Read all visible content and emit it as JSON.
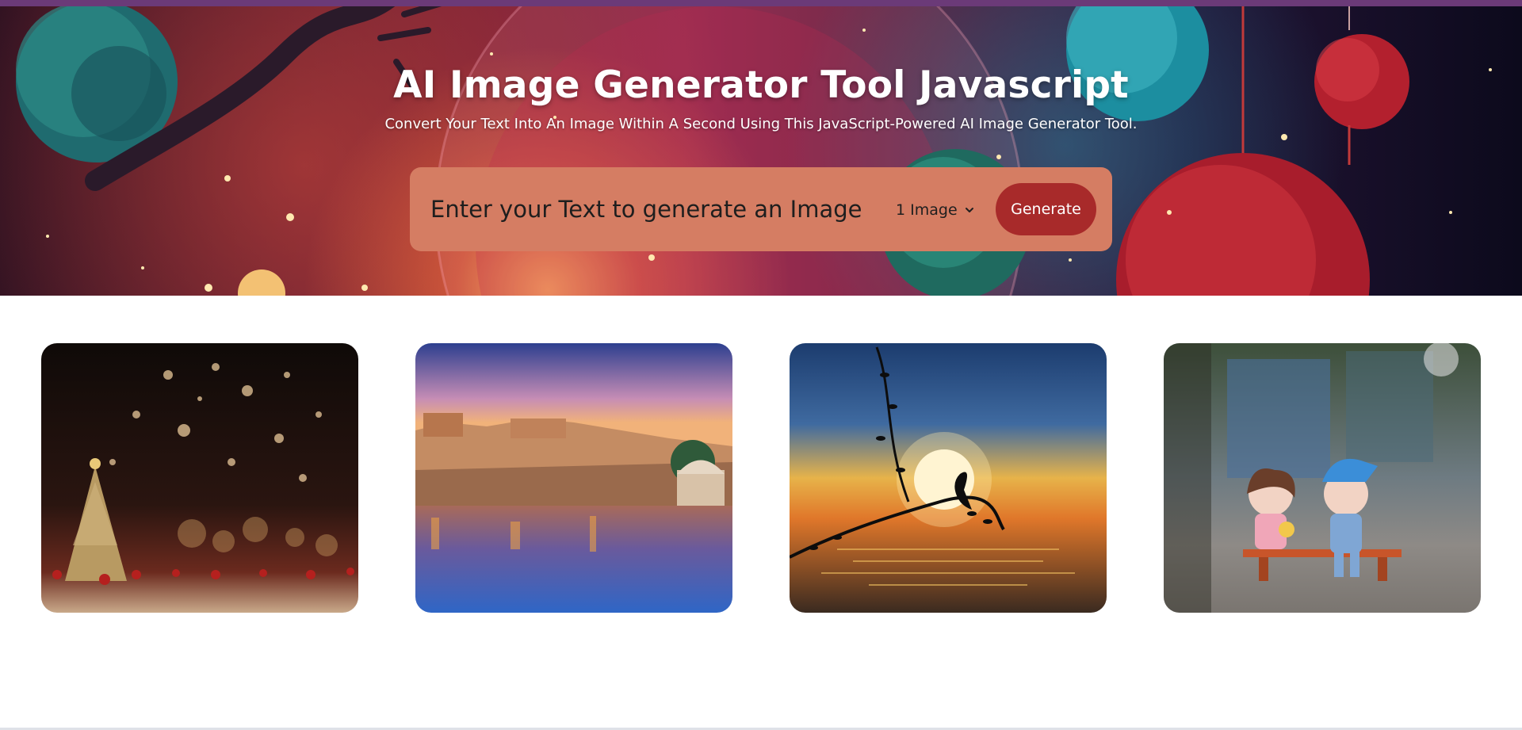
{
  "header": {
    "title": "AI Image Generator Tool Javascript",
    "subtitle": "Convert Your Text Into An Image Within A Second Using This JavaScript-Powered AI Image Generator Tool."
  },
  "form": {
    "prompt_placeholder": "Enter your Text to generate an Image",
    "prompt_value": "",
    "quantity_selected": "1 Image",
    "generate_label": "Generate"
  },
  "gallery": {
    "images": [
      {
        "subject": "christmas-tree-bokeh"
      },
      {
        "subject": "fort-lake-reflection"
      },
      {
        "subject": "bird-branch-sunset"
      },
      {
        "subject": "toy-couple-on-bench"
      }
    ]
  },
  "colors": {
    "search_box": "#d57d63",
    "generate_button": "#a82a2a",
    "top_strip": "#6b3a78"
  }
}
